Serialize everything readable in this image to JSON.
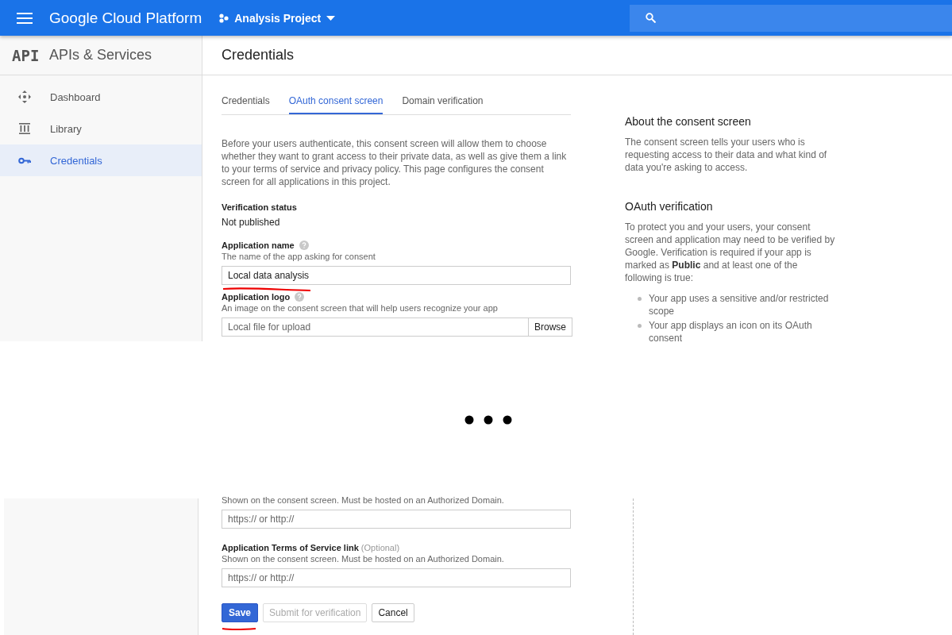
{
  "topbar": {
    "product": "Google Cloud Platform",
    "project": "Analysis Project"
  },
  "sidebar": {
    "logo": "API",
    "title": "APIs & Services",
    "items": [
      {
        "label": "Dashboard",
        "kind": "dashboard",
        "selected": false
      },
      {
        "label": "Library",
        "kind": "library",
        "selected": false
      },
      {
        "label": "Credentials",
        "kind": "key",
        "selected": true
      }
    ]
  },
  "page_title": "Credentials",
  "tabs": [
    {
      "label": "Credentials",
      "selected": false
    },
    {
      "label": "OAuth consent screen",
      "selected": true
    },
    {
      "label": "Domain verification",
      "selected": false
    }
  ],
  "intro": "Before your users authenticate, this consent screen will allow them to choose whether they want to grant access to their private data, as well as give them a link to your terms of service and privacy policy. This page configures the consent screen for all applications in this project.",
  "verification_status": {
    "label": "Verification status",
    "value": "Not published"
  },
  "application_name": {
    "label": "Application name",
    "hint": "The name of the app asking for consent",
    "value": "Local data analysis"
  },
  "application_logo": {
    "label": "Application logo",
    "hint": "An image on the consent screen that will help users recognize your app",
    "placeholder": "Local file for upload",
    "button": "Browse"
  },
  "form_bottom": [
    {
      "hint": "Shown on the consent screen. Must be hosted on an Authorized Domain.",
      "placeholder": "https:// or http://"
    },
    {
      "label": "Application Terms of Service link",
      "optional": "(Optional)",
      "hint": "Shown on the consent screen. Must be hosted on an Authorized Domain.",
      "placeholder": "https:// or http://"
    }
  ],
  "buttons": [
    {
      "label": "Save",
      "kind": "primary",
      "disabled": false
    },
    {
      "label": "Submit for verification",
      "kind": "secondary",
      "disabled": true
    },
    {
      "label": "Cancel",
      "kind": "secondary",
      "disabled": false
    }
  ],
  "aside": {
    "about_title": "About the consent screen",
    "about_text": "The consent screen tells your users who is requesting access to their data and what kind of data you're asking to access.",
    "oauth_title": "OAuth verification",
    "oauth_text": "To protect you and your users, your consent screen and application may need to be verified by Google. Verification is required if your app is marked as **Public** and at least one of the following is true:",
    "bullets": [
      "Your app uses a sensitive and/or restricted scope",
      "Your app displays an icon on its OAuth consent"
    ]
  }
}
